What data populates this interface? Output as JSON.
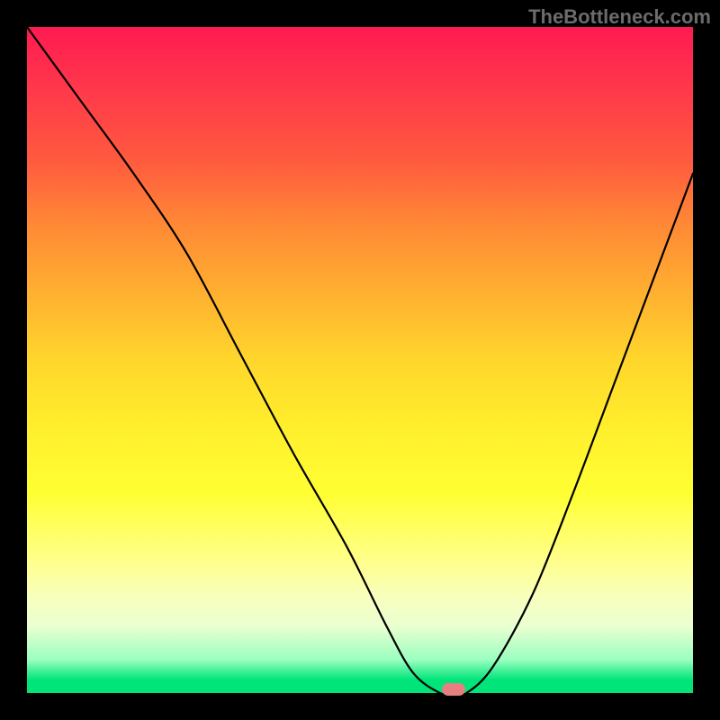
{
  "watermark": "TheBottleneck.com",
  "colors": {
    "frame": "#000000",
    "curve": "#000000",
    "marker": "#e77f80"
  },
  "chart_data": {
    "type": "line",
    "title": "",
    "xlabel": "",
    "ylabel": "",
    "xlim": [
      0,
      100
    ],
    "ylim": [
      0,
      100
    ],
    "grid": false,
    "series": [
      {
        "name": "bottleneck-curve",
        "x": [
          0,
          8,
          16,
          24,
          32,
          40,
          48,
          54,
          58,
          62,
          64,
          66,
          70,
          76,
          82,
          88,
          94,
          100
        ],
        "values": [
          100,
          89,
          78,
          66,
          51,
          36,
          22,
          10,
          3,
          0,
          0,
          0,
          4,
          15,
          30,
          46,
          62,
          78
        ]
      }
    ],
    "marker": {
      "x": 64,
      "y": 0
    }
  }
}
